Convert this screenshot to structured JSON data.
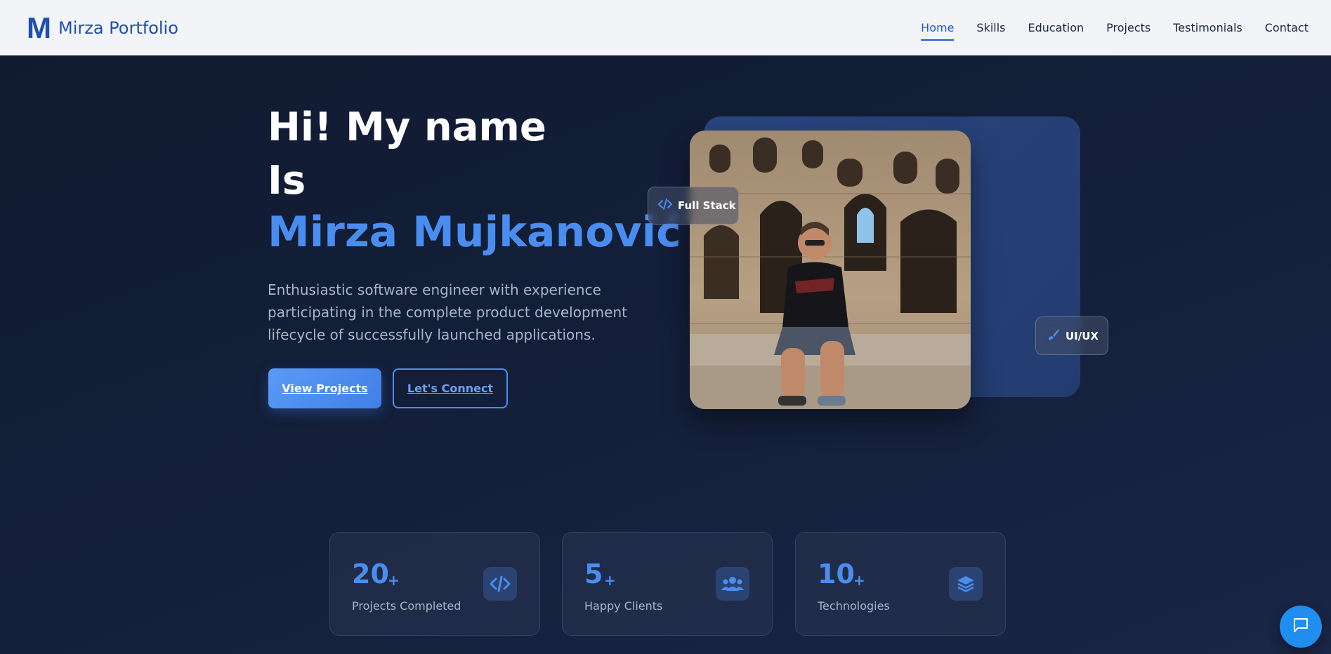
{
  "nav": {
    "logo_letter": "M",
    "brand": "Mirza Portfolio",
    "links": [
      "Home",
      "Skills",
      "Education",
      "Projects",
      "Testimonials",
      "Contact"
    ],
    "active": "Home"
  },
  "hero": {
    "title_line1": "Hi! My name",
    "title_line2": "Is",
    "name": "Mirza Mujkanović",
    "description": "Enthusiastic software engineer with experience participating in the complete product development lifecycle of successfully launched applications.",
    "primary_button": "View Projects",
    "secondary_button": "Let's Connect"
  },
  "badges": {
    "fullstack": {
      "label": "Full Stack",
      "icon": "code-icon"
    },
    "uiux": {
      "label": "UI/UX",
      "icon": "brush-icon"
    }
  },
  "stats": [
    {
      "value": "20",
      "suffix": "+",
      "label": "Projects Completed",
      "icon": "code-icon"
    },
    {
      "value": "5",
      "suffix": "+",
      "label": "Happy Clients",
      "icon": "users-icon"
    },
    {
      "value": "10",
      "suffix": "+",
      "label": "Technologies",
      "icon": "layers-icon"
    }
  ],
  "colors": {
    "accent": "#4a8df0",
    "brand": "#1f4fb0",
    "background": "#131d36",
    "chat": "#1f8ef0"
  }
}
